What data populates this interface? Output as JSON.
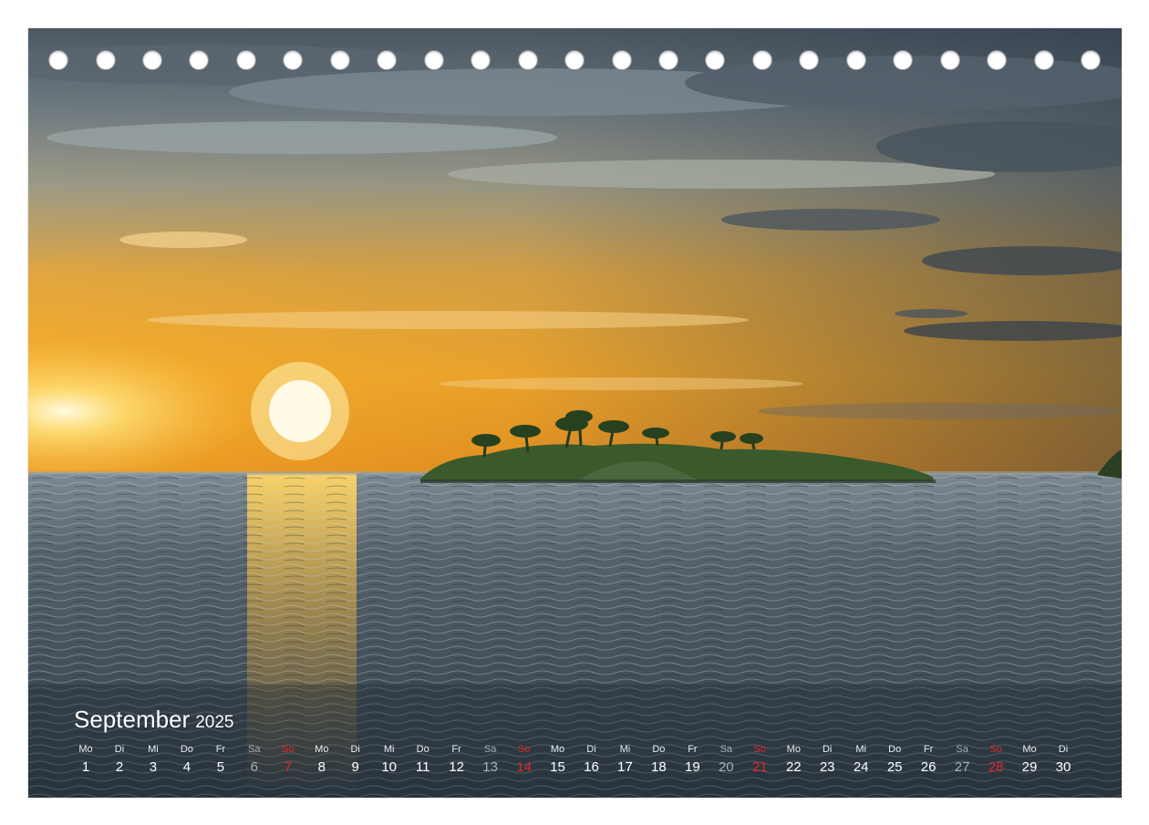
{
  "calendar": {
    "month": "September",
    "year": "2025",
    "days": [
      {
        "name": "Mo",
        "num": "1",
        "kind": "weekday"
      },
      {
        "name": "Di",
        "num": "2",
        "kind": "weekday"
      },
      {
        "name": "Mi",
        "num": "3",
        "kind": "weekday"
      },
      {
        "name": "Do",
        "num": "4",
        "kind": "weekday"
      },
      {
        "name": "Fr",
        "num": "5",
        "kind": "weekday"
      },
      {
        "name": "Sa",
        "num": "6",
        "kind": "saturday"
      },
      {
        "name": "So",
        "num": "7",
        "kind": "sunday"
      },
      {
        "name": "Mo",
        "num": "8",
        "kind": "weekday"
      },
      {
        "name": "Di",
        "num": "9",
        "kind": "weekday"
      },
      {
        "name": "Mi",
        "num": "10",
        "kind": "weekday"
      },
      {
        "name": "Do",
        "num": "11",
        "kind": "weekday"
      },
      {
        "name": "Fr",
        "num": "12",
        "kind": "weekday"
      },
      {
        "name": "Sa",
        "num": "13",
        "kind": "saturday"
      },
      {
        "name": "So",
        "num": "14",
        "kind": "sunday"
      },
      {
        "name": "Mo",
        "num": "15",
        "kind": "weekday"
      },
      {
        "name": "Di",
        "num": "16",
        "kind": "weekday"
      },
      {
        "name": "Mi",
        "num": "17",
        "kind": "weekday"
      },
      {
        "name": "Do",
        "num": "18",
        "kind": "weekday"
      },
      {
        "name": "Fr",
        "num": "19",
        "kind": "weekday"
      },
      {
        "name": "Sa",
        "num": "20",
        "kind": "saturday"
      },
      {
        "name": "So",
        "num": "21",
        "kind": "sunday"
      },
      {
        "name": "Mo",
        "num": "22",
        "kind": "weekday"
      },
      {
        "name": "Di",
        "num": "23",
        "kind": "weekday"
      },
      {
        "name": "Mi",
        "num": "24",
        "kind": "weekday"
      },
      {
        "name": "Do",
        "num": "25",
        "kind": "weekday"
      },
      {
        "name": "Fr",
        "num": "26",
        "kind": "weekday"
      },
      {
        "name": "Sa",
        "num": "27",
        "kind": "saturday"
      },
      {
        "name": "So",
        "num": "28",
        "kind": "sunday"
      },
      {
        "name": "Mo",
        "num": "29",
        "kind": "weekday"
      },
      {
        "name": "Di",
        "num": "30",
        "kind": "weekday"
      }
    ]
  },
  "colors": {
    "sunday": "#e0262b",
    "saturday": "#a7aeb4",
    "weekday": "#ffffff",
    "sun": "#fff6c8",
    "sky_warm": "#f4a623",
    "sea": "#3f4c57"
  },
  "binding": {
    "hole_count": 23
  }
}
